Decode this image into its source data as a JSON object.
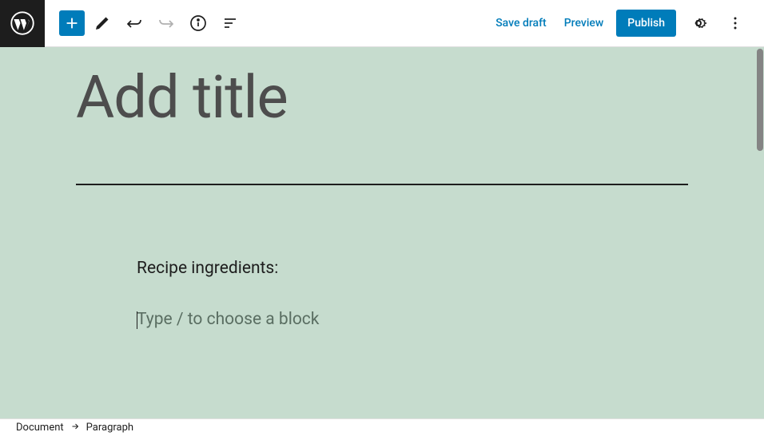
{
  "toolbar": {
    "save_draft": "Save draft",
    "preview": "Preview",
    "publish": "Publish"
  },
  "editor": {
    "title_placeholder": "Add title",
    "paragraph": "Recipe ingredients:",
    "block_placeholder": "Type / to choose a block"
  },
  "breadcrumb": {
    "root": "Document",
    "current": "Paragraph"
  }
}
